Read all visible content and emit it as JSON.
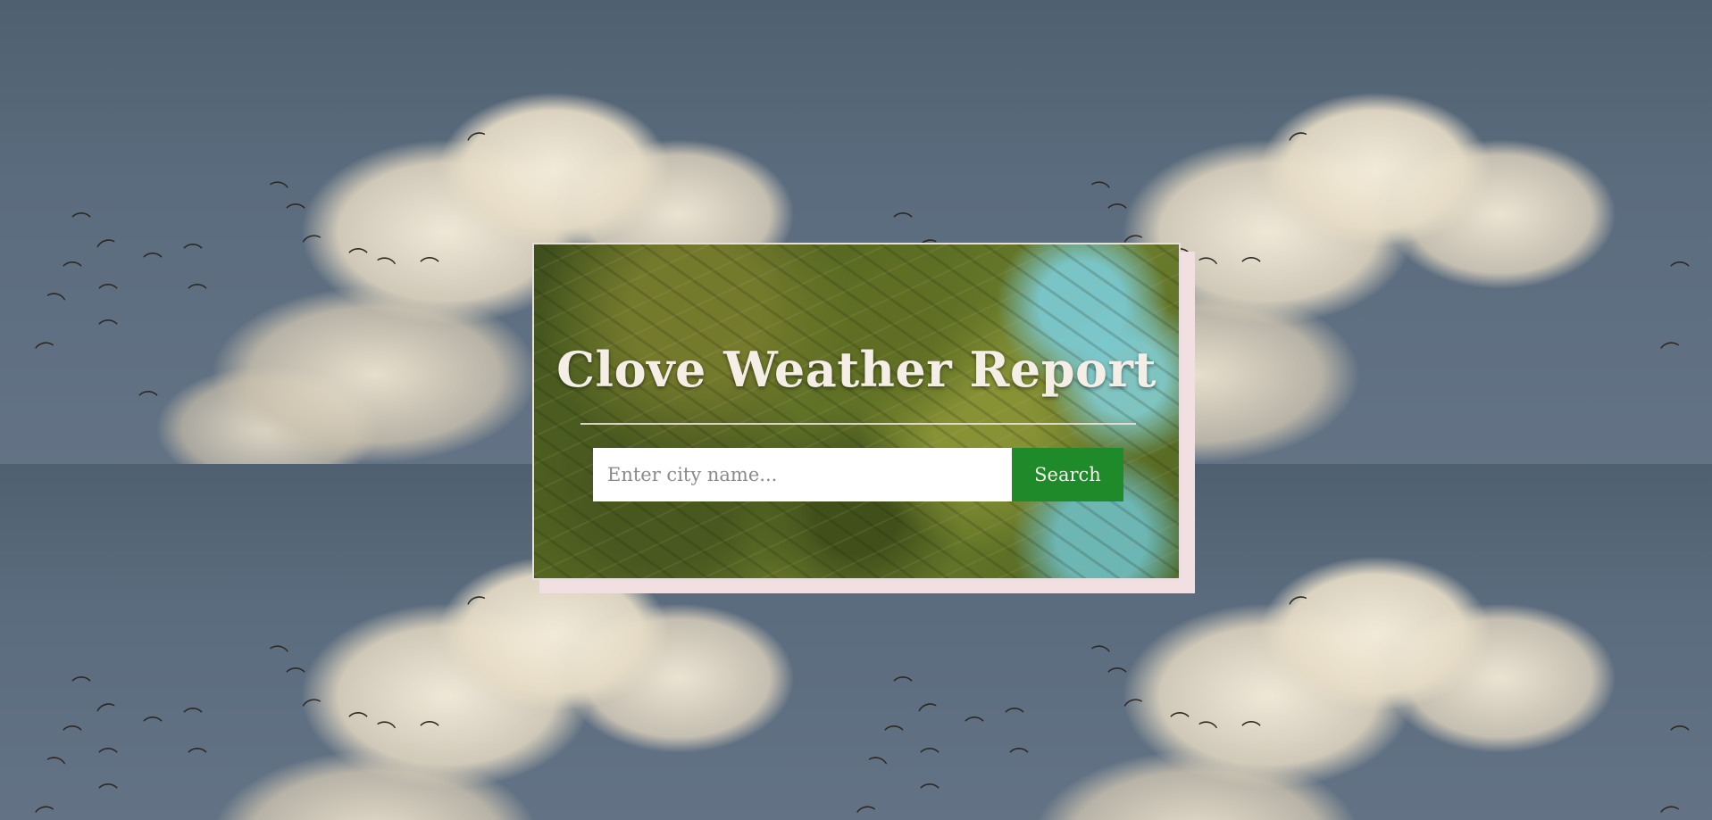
{
  "app": {
    "title": "Clove Weather Report"
  },
  "search": {
    "placeholder": "Enter city name...",
    "value": "",
    "button_label": "Search"
  },
  "colors": {
    "button_bg": "#1f8a2a",
    "title_text": "#f5eee6",
    "card_shadow": "#f1dfe2"
  },
  "icons": {
    "bird": "bird-icon"
  }
}
